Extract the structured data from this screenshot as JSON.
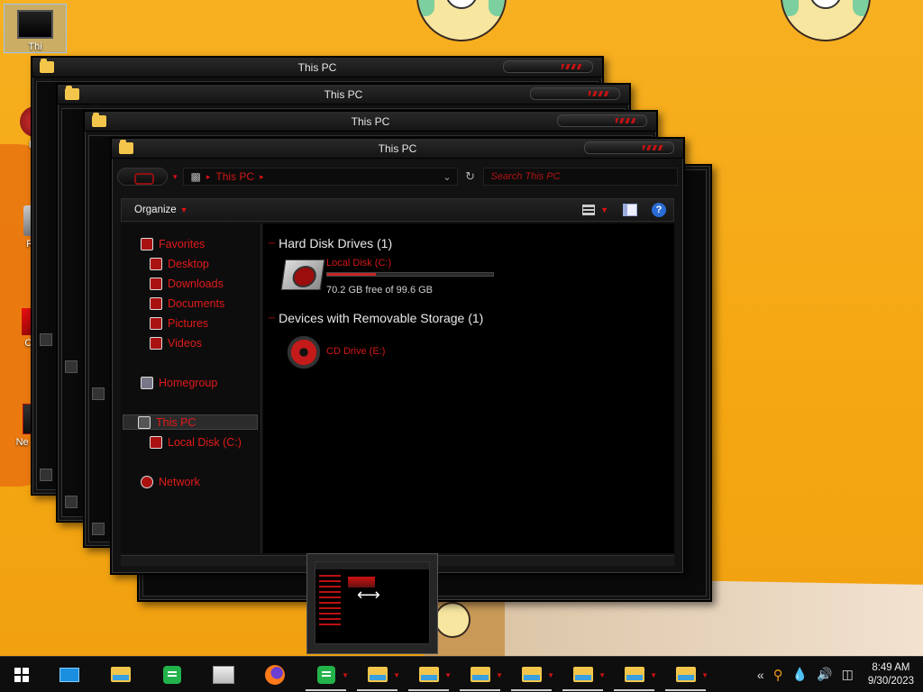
{
  "desktop": {
    "icons": [
      {
        "label": "Thi"
      },
      {
        "label": "Ne"
      },
      {
        "label": "Rec"
      },
      {
        "label": "Cont"
      },
      {
        "label": "Ne Docu"
      }
    ]
  },
  "windows": {
    "stack_titles": [
      "This PC",
      "This PC",
      "This PC",
      "This PC"
    ]
  },
  "explorer": {
    "title": "This PC",
    "address": "This PC",
    "search_placeholder": "Search This PC",
    "toolbar": {
      "organize": "Organize"
    },
    "nav": {
      "favorites": "Favorites",
      "desktop": "Desktop",
      "downloads": "Downloads",
      "documents": "Documents",
      "pictures": "Pictures",
      "videos": "Videos",
      "homegroup": "Homegroup",
      "this_pc": "This PC",
      "local_disk": "Local Disk (C:)",
      "network": "Network"
    },
    "groups": {
      "hdd": "Hard Disk Drives (1)",
      "removable": "Devices with Removable Storage (1)"
    },
    "drives": {
      "c_name": "Local Disk (C:)",
      "c_free": "70.2 GB free of 99.6 GB",
      "c_used_fraction": 0.295,
      "e_name": "CD Drive (E:)"
    }
  },
  "taskbar": {
    "time": "8:49 AM",
    "date": "9/30/2023"
  }
}
